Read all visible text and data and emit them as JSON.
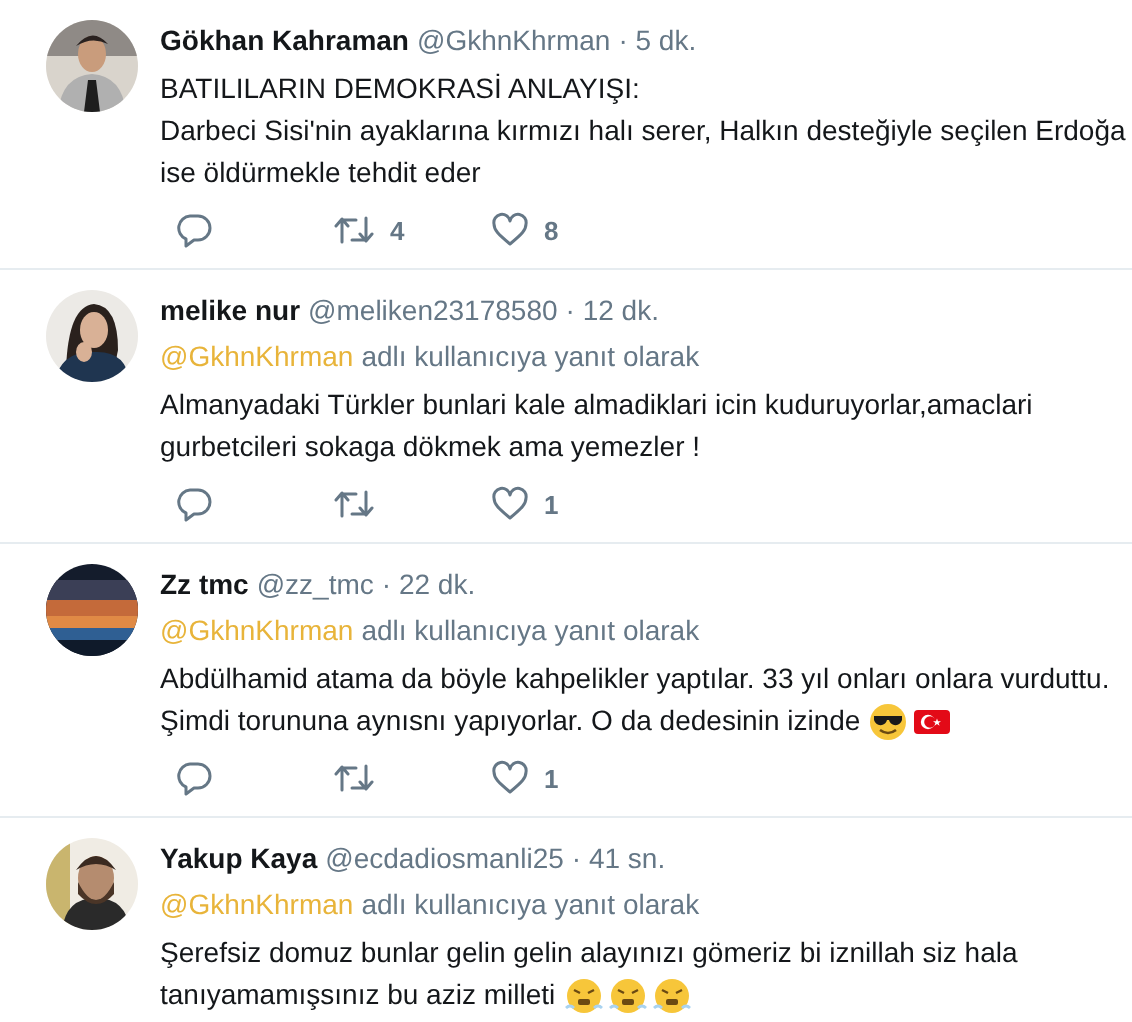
{
  "tweets": [
    {
      "name": "Gökhan Kahraman",
      "handle": "@GkhnKhrman",
      "time": "· 5 dk.",
      "lines": [
        {
          "text": "BATILILARIN DEMOKRASİ ANLAYIŞI:"
        },
        {
          "text": "Darbeci Sisi'nin ayaklarına kırmızı halı serer, Halkın desteğiyle seçilen Erdoğa"
        },
        {
          "text": "ise öldürmekle tehdit eder"
        }
      ],
      "actions": [
        {
          "kind": "reply"
        },
        {
          "kind": "retweet",
          "count": "4"
        },
        {
          "kind": "like",
          "count": "8"
        }
      ]
    },
    {
      "name": "melike nur",
      "handle": "@meliken23178580",
      "time": "· 12 dk.",
      "reply_to": {
        "mention": "@GkhnKhrman",
        "text": "adlı kullanıcıya yanıt olarak"
      },
      "lines": [
        {
          "text": "Almanyadaki Türkler bunlari kale almadiklari icin kuduruyorlar,amaclari"
        },
        {
          "text": "gurbetcileri sokaga dökmek ama yemezler !"
        }
      ],
      "actions": [
        {
          "kind": "reply"
        },
        {
          "kind": "retweet"
        },
        {
          "kind": "like",
          "count": "1"
        }
      ]
    },
    {
      "name": "Zz tmc",
      "handle": "@zz_tmc",
      "time": "· 22 dk.",
      "reply_to": {
        "mention": "@GkhnKhrman",
        "text": "adlı kullanıcıya yanıt olarak"
      },
      "lines": [
        {
          "text": "Abdülhamid atama da böyle kahpelikler yaptılar. 33 yıl onları onlara vurduttu."
        },
        {
          "text": "Şimdi torununa aynısnı yapıyorlar. O da dedesinin izinde",
          "icons": [
            {
              "kind": "sunglasses"
            },
            {
              "kind": "flag"
            }
          ]
        }
      ],
      "actions": [
        {
          "kind": "reply"
        },
        {
          "kind": "retweet"
        },
        {
          "kind": "like",
          "count": "1"
        }
      ]
    },
    {
      "name": "Yakup Kaya",
      "handle": "@ecdadiosmanli25",
      "time": "· 41 sn.",
      "reply_to": {
        "mention": "@GkhnKhrman",
        "text": "adlı kullanıcıya yanıt olarak"
      },
      "lines": [
        {
          "text": "Şerefsiz domuz bunlar gelin gelin alayınızı gömeriz bi iznillah siz hala"
        },
        {
          "text": "tanıyamamışsınız bu aziz milleti",
          "icons": [
            {
              "kind": "steam"
            },
            {
              "kind": "steam"
            },
            {
              "kind": "steam"
            }
          ]
        }
      ]
    }
  ]
}
